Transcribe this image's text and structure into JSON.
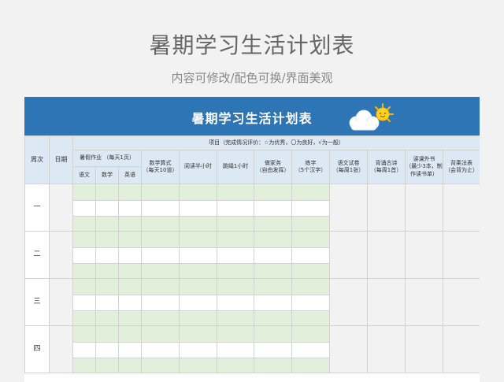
{
  "header": {
    "title": "暑期学习生活计划表",
    "subtitle": "内容可修改/配色可换/界面美观"
  },
  "sheet": {
    "title": "暑期学习生活计划表",
    "colors": {
      "banner": "#2e75b6",
      "header": "#dce8f4",
      "green": "#e2efda",
      "gray": "#f2f2f2"
    },
    "icon": "sun-cloud-icon"
  },
  "table": {
    "col_week": "周次",
    "col_date": "日期",
    "project_header": "项目（完成情况评价：☆为优秀，〇为良好，√为一般）",
    "homework_header": "暑假作业 （每天1页）",
    "homework_sub": [
      "语文",
      "数学",
      "英语"
    ],
    "tasks": [
      {
        "name": "数学算式",
        "note": "（每天10道）"
      },
      {
        "name": "阅读半小时",
        "note": ""
      },
      {
        "name": "跳绳1小时",
        "note": ""
      },
      {
        "name": "做家务",
        "note": "（自由发挥）"
      },
      {
        "name": "练字",
        "note": "（5个汉字）"
      },
      {
        "name": "语文试卷",
        "note": "（每周1张）"
      },
      {
        "name": "背诵古诗",
        "note": "（每周1首）"
      },
      {
        "name": "读课外书",
        "note": "（最少3本，制作读书单）"
      },
      {
        "name": "背乘法表",
        "note": "（会背为止）"
      }
    ],
    "weeks": [
      "一",
      "二",
      "三",
      "四"
    ]
  }
}
